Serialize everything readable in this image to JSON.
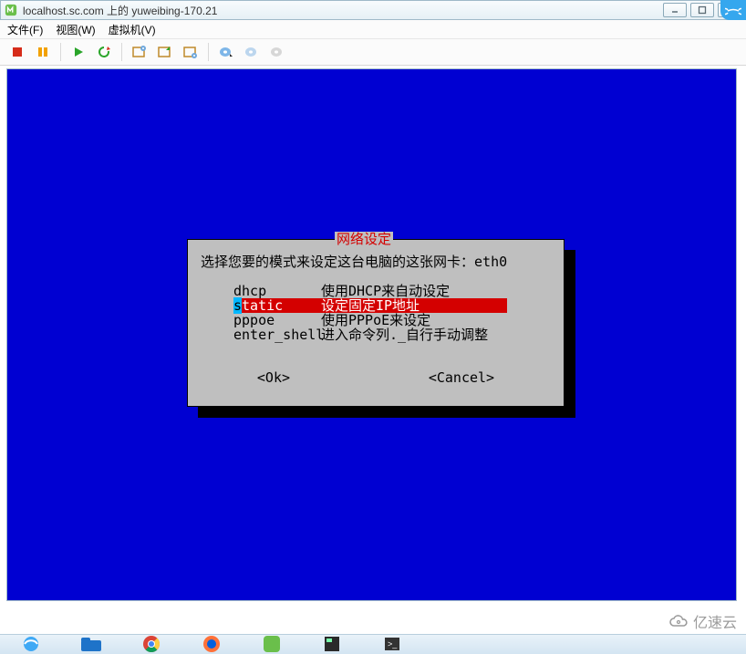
{
  "titlebar": {
    "text": "localhost.sc.com 上的 yuweibing-170.21"
  },
  "corner_badge": "∞",
  "menubar": {
    "file": "文件(F)",
    "view": "视图(W)",
    "vm": "虚拟机(V)"
  },
  "toolbar": {
    "icons": [
      "stop",
      "pause",
      "play",
      "refresh",
      "snapshot-clock",
      "snapshot-mgr",
      "settings-cd",
      "floppy",
      "mouse",
      "keyboard"
    ]
  },
  "dialog": {
    "caption": "网络设定",
    "prompt": "选择您要的模式来设定这台电脑的这张网卡：eth0",
    "options": [
      {
        "key": "dhcp",
        "desc": "使用DHCP来自动设定",
        "selected": false
      },
      {
        "key": "static",
        "desc": "设定固定IP地址",
        "selected": true
      },
      {
        "key": "pppoe",
        "desc": "使用PPPoE来设定",
        "selected": false
      },
      {
        "key": "enter_shell",
        "desc": "进入命令列._自行手动调整",
        "selected": false
      }
    ],
    "ok": "<Ok>",
    "cancel": "<Cancel>"
  },
  "watermark": "亿速云"
}
